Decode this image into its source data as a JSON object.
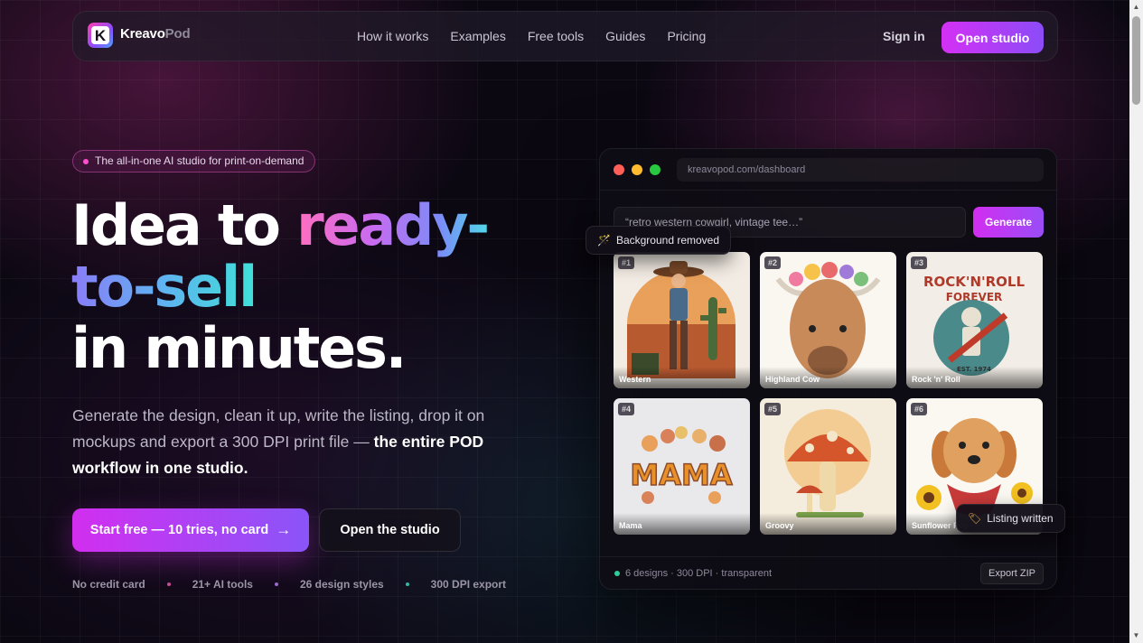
{
  "brand": {
    "name_a": "Kreavo",
    "name_b": "Pod",
    "logo_letter": "K"
  },
  "nav": {
    "links": [
      "How it works",
      "Examples",
      "Free tools",
      "Guides",
      "Pricing"
    ],
    "sign_in": "Sign in",
    "open_studio": "Open studio"
  },
  "hero": {
    "pill": "The all-in-one AI studio for print-on-demand",
    "title_line1_plain": "Idea to ",
    "title_line1_grad": "ready-",
    "title_line2_grad": "to-sell",
    "title_line3": "in minutes.",
    "sub_plain": "Generate the design, clean it up, write the listing, drop it on mockups and export a 300 DPI print file — ",
    "sub_bold": "the entire POD workflow in one studio.",
    "cta_primary": "Start free — 10 tries, no card",
    "cta_primary_arrow": "→",
    "cta_secondary": "Open the studio",
    "stats": [
      "No credit card",
      "21+ AI tools",
      "26 design styles",
      "300 DPI export"
    ]
  },
  "dashboard": {
    "url": "kreavopod.com/dashboard",
    "prompt": "“retro western cowgirl, vintage tee…”",
    "generate": "Generate",
    "designs": [
      {
        "num": "#1",
        "caption": "Western"
      },
      {
        "num": "#2",
        "caption": "Highland Cow"
      },
      {
        "num": "#3",
        "caption": "Rock 'n' Roll"
      },
      {
        "num": "#4",
        "caption": "Mama"
      },
      {
        "num": "#5",
        "caption": "Groovy"
      },
      {
        "num": "#6",
        "caption": "Sunflower Pup"
      }
    ],
    "footer_status": "6 designs · 300 DPI · transparent",
    "export": "Export ZIP",
    "toast_bg": "Background removed",
    "toast_listing": "Listing written"
  },
  "icons": [
    "wand-icon",
    "tag-icon",
    "arrow-right-icon"
  ],
  "colors": {
    "accent": "#d22ef0",
    "accent2": "#8a55f8",
    "status_green": "#2ecc99"
  }
}
